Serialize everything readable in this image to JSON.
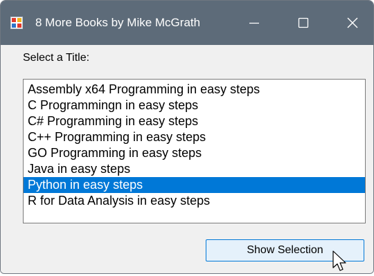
{
  "window": {
    "title": "8 More Books by Mike McGrath"
  },
  "form": {
    "prompt_label": "Select a Title:",
    "list_items": [
      "Assembly x64 Programming in easy steps",
      "C Programmingn in easy steps",
      "C# Programming in easy steps",
      "C++ Programming in easy steps",
      "GO Programming in easy steps",
      "Java in easy steps",
      "Python in easy steps",
      "R for Data Analysis in easy steps"
    ],
    "selected_item": "Python in easy steps",
    "show_button_label": "Show Selection"
  },
  "icons": {
    "app": "window-app-icon",
    "minimize": "minimize-icon",
    "maximize": "maximize-icon",
    "close": "close-icon",
    "cursor": "mouse-pointer-icon"
  },
  "colors": {
    "titlebar": "#5d6b79",
    "selection": "#0078d7",
    "button_face": "#e5f1fb",
    "button_border": "#0078d7",
    "client_background": "#f0f0f0"
  }
}
